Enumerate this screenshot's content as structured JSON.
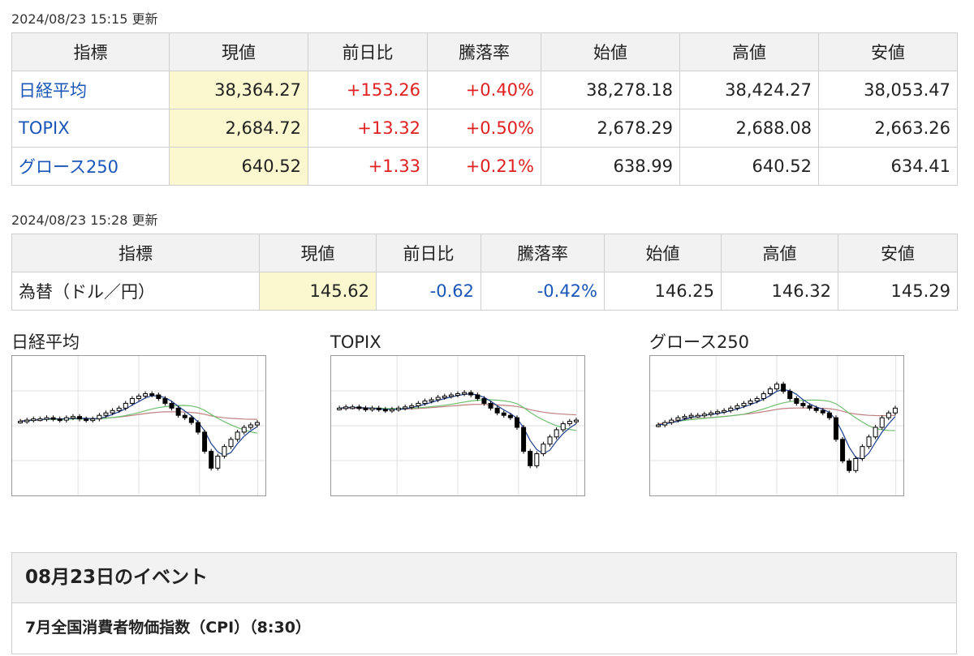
{
  "stock_table": {
    "updated": "2024/08/23 15:15 更新",
    "headers": [
      "指標",
      "現値",
      "前日比",
      "騰落率",
      "始値",
      "高値",
      "安値"
    ],
    "rows": [
      {
        "name": "日経平均",
        "current": "38,364.27",
        "change": "+153.26",
        "rate": "+0.40%",
        "open": "38,278.18",
        "high": "38,424.27",
        "low": "38,053.47"
      },
      {
        "name": "TOPIX",
        "current": "2,684.72",
        "change": "+13.32",
        "rate": "+0.50%",
        "open": "2,678.29",
        "high": "2,688.08",
        "low": "2,663.26"
      },
      {
        "name": "グロース250",
        "current": "640.52",
        "change": "+1.33",
        "rate": "+0.21%",
        "open": "638.99",
        "high": "640.52",
        "low": "634.41"
      }
    ]
  },
  "fx_table": {
    "updated": "2024/08/23 15:28 更新",
    "headers": [
      "指標",
      "現値",
      "前日比",
      "騰落率",
      "始値",
      "高値",
      "安値"
    ],
    "rows": [
      {
        "name": "為替（ドル／円）",
        "current": "145.62",
        "change": "-0.62",
        "rate": "-0.42%",
        "open": "146.25",
        "high": "146.32",
        "low": "145.29"
      }
    ]
  },
  "charts": {
    "nikkei_title": "日経平均",
    "topix_title": "TOPIX",
    "growth_title": "グロース250",
    "colors": {
      "candle": "#000000",
      "ma_short": "#1f3f8f",
      "ma_mid": "#6fbf6f",
      "ma_long": "#c08080",
      "grid": "#e0e0e0"
    }
  },
  "events": {
    "heading": "08月23日のイベント",
    "items": [
      "7月全国消費者物価指数（CPI）（8:30）"
    ]
  },
  "colors": {
    "up": "#e02020",
    "down": "#1a56b8",
    "link": "#1a56b8",
    "current_bg": "#fbf8d0",
    "header_bg": "#f2f2f2"
  }
}
